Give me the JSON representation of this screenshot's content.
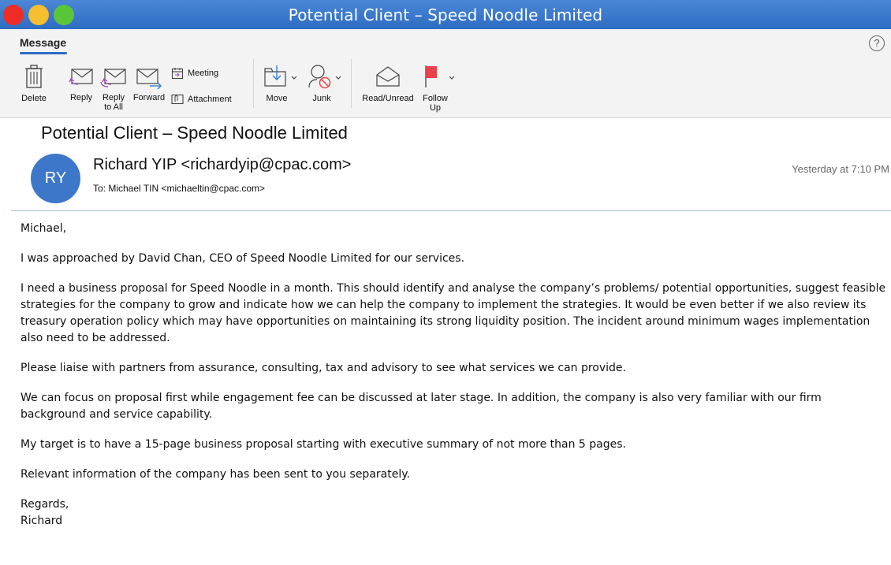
{
  "window": {
    "title": "Potential Client – Speed Noodle Limited"
  },
  "ribbon": {
    "tab": "Message",
    "help": "?",
    "buttons": {
      "delete": "Delete",
      "reply": "Reply",
      "reply_all_line1": "Reply",
      "reply_all_line2": "to All",
      "forward": "Forward",
      "meeting": "Meeting",
      "attachment": "Attachment",
      "move": "Move",
      "junk": "Junk",
      "read_unread": "Read/Unread",
      "follow_up_line1": "Follow",
      "follow_up_line2": "Up"
    }
  },
  "message": {
    "subject": "Potential Client – Speed Noodle Limited",
    "avatar_initials": "RY",
    "from": "Richard YIP <richardyip@cpac.com>",
    "to": "To:  Michael TIN <michaeltin@cpac.com>",
    "time": "Yesterday at 7:10 PM",
    "body": {
      "greeting": "Michael,",
      "p1": "I was approached by David Chan, CEO of Speed Noodle Limited for our services.",
      "p2": "I need a business proposal for Speed Noodle in a month. This should identify and analyse the company’s problems/ potential opportunities, suggest feasible strategies for the company to grow and indicate how we can help the company to implement the strategies. It would be even better if we also review its treasury operation policy which may have opportunities on maintaining its strong liquidity position. The incident around minimum wages implementation also need to be addressed.",
      "p3": "Please liaise with partners from assurance, consulting, tax and advisory to see what services we can provide.",
      "p4": "We can focus on proposal first while engagement fee can be discussed at later stage. In addition, the company is also very familiar with our firm background and service capability.",
      "p5": "My target is to have a 15-page business proposal starting with executive summary of not more than 5 pages.",
      "p6": "Relevant information of the company has been sent to you separately.",
      "regards": "Regards,",
      "signature": "Richard"
    }
  },
  "colors": {
    "titlebar": "#3a78cc",
    "accent": "#2c6bc4",
    "avatar": "#3d77c9",
    "flag": "#e8424a"
  },
  "icons": [
    "close-window-icon",
    "minimize-window-icon",
    "zoom-window-icon",
    "help-icon",
    "trash-icon",
    "reply-icon",
    "reply-all-icon",
    "forward-icon",
    "calendar-icon",
    "attachment-icon",
    "move-folder-icon",
    "junk-icon",
    "envelope-open-icon",
    "flag-icon"
  ]
}
